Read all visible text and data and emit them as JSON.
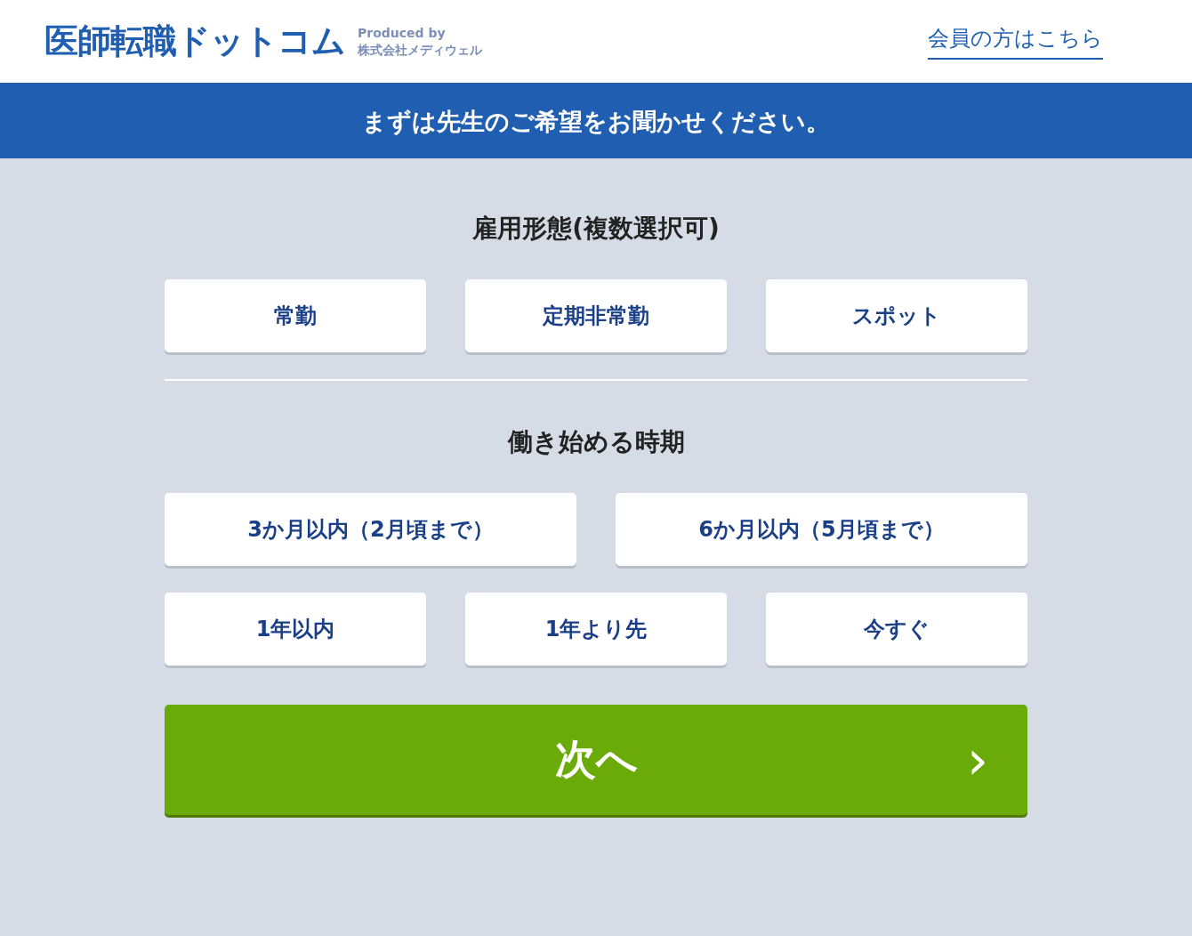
{
  "header": {
    "logo": "医師転職ドットコム",
    "produced_by": "Produced by",
    "company": "株式会社メディウェル",
    "member_link": "会員の方はこちら"
  },
  "banner": "まずは先生のご希望をお聞かせください。",
  "employment": {
    "title": "雇用形態(複数選択可)",
    "options": [
      {
        "label": "常勤",
        "selected": false
      },
      {
        "label": "定期非常勤",
        "selected": false
      },
      {
        "label": "スポット",
        "selected": false
      }
    ]
  },
  "start_timing": {
    "title": "働き始める時期",
    "options": [
      {
        "label": "3か月以内（2月頃まで）",
        "selected": false
      },
      {
        "label": "6か月以内（5月頃まで）",
        "selected": false
      },
      {
        "label": "1年以内",
        "selected": false
      },
      {
        "label": "1年より先",
        "selected": false
      },
      {
        "label": "今すぐ",
        "selected": false
      }
    ]
  },
  "next_button": {
    "label": "次へ",
    "icon": "›"
  }
}
